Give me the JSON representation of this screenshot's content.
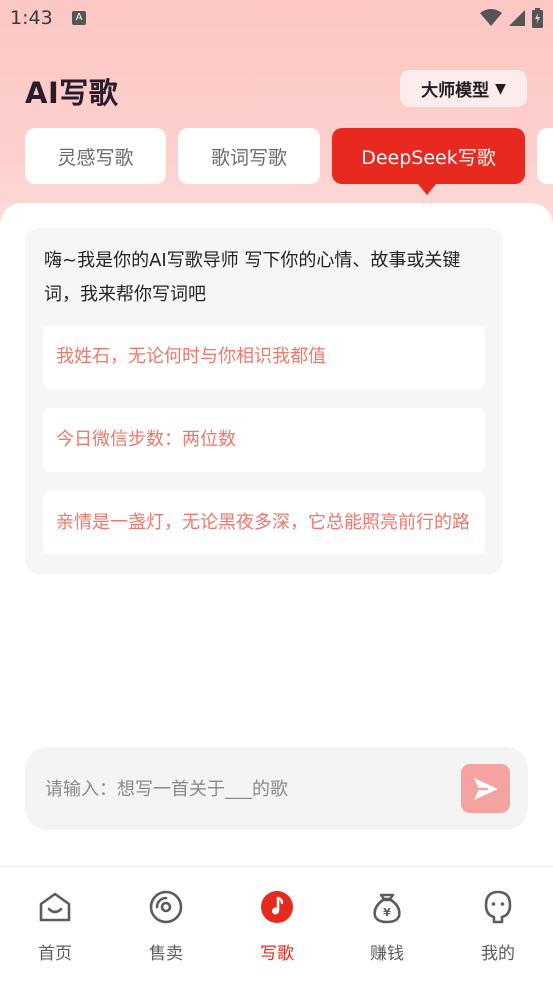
{
  "status_bar": {
    "time": "1:43",
    "notification_badge": "A"
  },
  "header": {
    "title": "AI写歌",
    "model_selector": {
      "label": "大师模型",
      "caret": "▼"
    }
  },
  "tabs": [
    {
      "label": "灵感写歌",
      "active": false
    },
    {
      "label": "歌词写歌",
      "active": false
    },
    {
      "label": "DeepSeek写歌",
      "active": true
    }
  ],
  "chat": {
    "greeting": "嗨~我是你的AI写歌导师 写下你的心情、故事或关键词，我来帮你写词吧",
    "suggestions": [
      "我姓石，无论何时与你相识我都值",
      "今日微信步数：两位数",
      "亲情是一盏灯，无论黑夜多深，它总能照亮前行的路"
    ]
  },
  "input": {
    "placeholder": "请输入：想写一首关于___的歌",
    "value": ""
  },
  "bottom_nav": [
    {
      "label": "首页",
      "icon": "home-icon",
      "active": false
    },
    {
      "label": "售卖",
      "icon": "disc-icon",
      "active": false
    },
    {
      "label": "写歌",
      "icon": "music-note-icon",
      "active": true
    },
    {
      "label": "赚钱",
      "icon": "money-bag-icon",
      "active": false
    },
    {
      "label": "我的",
      "icon": "profile-icon",
      "active": false
    }
  ],
  "colors": {
    "accent": "#e8291f",
    "suggestion_text": "#f0776b",
    "send_button": "#f4a3a0",
    "header_bg": "#fcc7c4"
  }
}
